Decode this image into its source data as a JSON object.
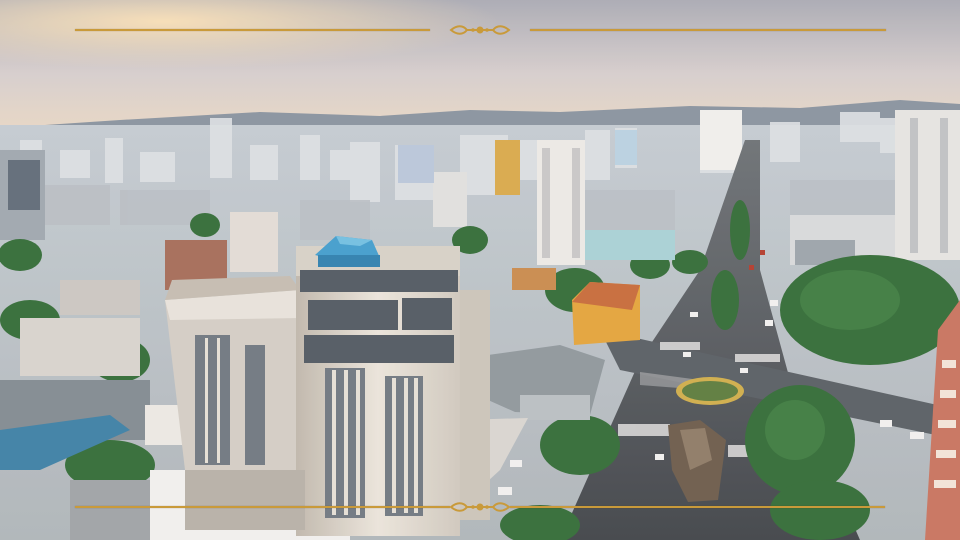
{
  "scene": {
    "icon": "aerial-city-photo",
    "colors": {
      "sky_top": "#b6b8c2",
      "sky_glow": "#f3d7b0",
      "haze": "#c8cfd4",
      "greenery": "#2f6b35",
      "street": "#4c545b",
      "accent_gold": "#c99a3a"
    }
  },
  "frame_decoration": {
    "icon": "gold-ornamental-divider"
  }
}
